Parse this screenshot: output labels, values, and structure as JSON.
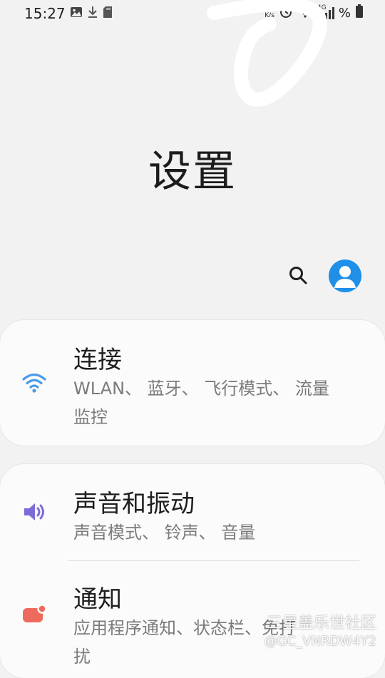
{
  "status_bar": {
    "time": "15:27",
    "net_speed_value": "22",
    "net_speed_unit": "K/s",
    "network_type": "4G",
    "battery_text": "%"
  },
  "header": {
    "title": "设置"
  },
  "items": [
    {
      "title": "连接",
      "subtitle": "WLAN、 蓝牙、 飞行模式、 流量监控",
      "icon": "wifi-icon",
      "icon_color": "#4a9be8"
    },
    {
      "title": "声音和振动",
      "subtitle": "声音模式、 铃声、 音量",
      "icon": "volume-icon",
      "icon_color": "#7b6cd8"
    },
    {
      "title": "通知",
      "subtitle": "应用程序通知、状态栏、免打扰",
      "icon": "notification-icon",
      "icon_color": "#ef6a5c"
    }
  ],
  "watermark": {
    "line1": "三星盖乐世社区",
    "line2": "@GC_VNRDW4Y2"
  },
  "colors": {
    "background": "#f2f2f2",
    "card": "#fbfbfb",
    "accent_blue": "#1f8fe8"
  }
}
